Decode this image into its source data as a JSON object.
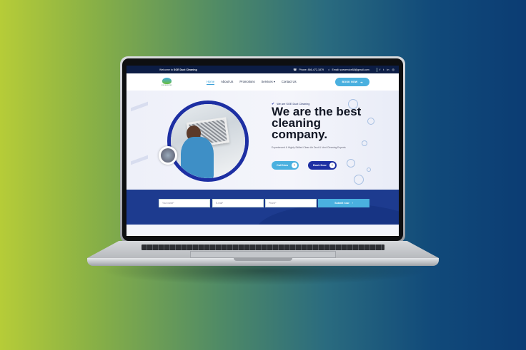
{
  "topbar": {
    "welcome_prefix": "Welcome to",
    "welcome_brand": "SOE Duct Cleaning",
    "phone": "Phone: 866-472-1879",
    "email": "Email: soeservice88@gmail.com",
    "socials": [
      "facebook-icon",
      "twitter-icon",
      "linkedin-icon",
      "instagram-icon"
    ]
  },
  "logo": {
    "text": "SOE SERVICES"
  },
  "nav": {
    "items": [
      {
        "label": "Home",
        "active": true
      },
      {
        "label": "About Us"
      },
      {
        "label": "Promotions"
      },
      {
        "label": "Services ▾"
      },
      {
        "label": "Contact Us"
      }
    ],
    "book_label": "BOOK NOW"
  },
  "hero": {
    "kicker": "We are SOE Duct Cleaning",
    "headline": "We are the best cleaning company.",
    "subtext": "Experienced & Highly Skilled Clean Air Duct & Vent Cleaning Experts",
    "call_label": "Call Now",
    "book_label": "Book Now"
  },
  "form": {
    "name_placeholder": "Your name*",
    "email_placeholder": "E-mail*",
    "phone_placeholder": "Phone*",
    "submit_label": "Submit now"
  },
  "colors": {
    "navy": "#0c1d45",
    "accent_blue": "#4ab0df",
    "royal": "#1d2fa3",
    "form_bg": "#1d3b8f"
  }
}
